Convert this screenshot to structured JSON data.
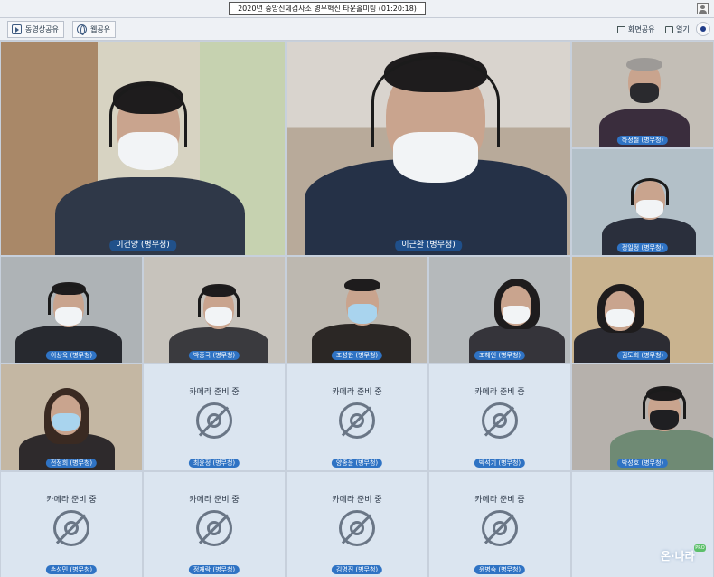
{
  "header": {
    "title": "2020년 중앙신체검사소 병무혁신 타운홀미팅 (01:20:18)"
  },
  "toolbar": {
    "video_share_label": "동영상공유",
    "web_share_label": "웹공유",
    "screen_share_label": "화면공유",
    "open_label": "열기"
  },
  "placeholder_text": "카메라 준비 중",
  "participants": [
    {
      "name": "이건양 (병무청)"
    },
    {
      "name": "이근환 (병무청)"
    },
    {
      "name": "하정철 (병무청)"
    },
    {
      "name": "정일정 (병무청)"
    },
    {
      "name": "이상욱 (병무청)"
    },
    {
      "name": "박종국 (병무청)"
    },
    {
      "name": "조성한 (병무청)"
    },
    {
      "name": "조해인 (병무청)"
    },
    {
      "name": "김도희 (병무청)"
    },
    {
      "name": "전정희 (병무청)"
    },
    {
      "name": "최윤정 (병무청)"
    },
    {
      "name": "양종운 (병무청)"
    },
    {
      "name": "박석기 (병무청)"
    },
    {
      "name": "박성호 (병무청)"
    },
    {
      "name": "손성민 (병무청)"
    },
    {
      "name": "정재락 (병무청)"
    },
    {
      "name": "김명진 (병무청)"
    },
    {
      "name": "윤병숙 (병무청)"
    }
  ],
  "brand": {
    "logo_text": "온·나라",
    "badge_text": "PRO"
  },
  "colors": {
    "accent": "#2f73c4",
    "placeholder_bg": "#dbe5f0",
    "toggle": "#1f3c88"
  }
}
